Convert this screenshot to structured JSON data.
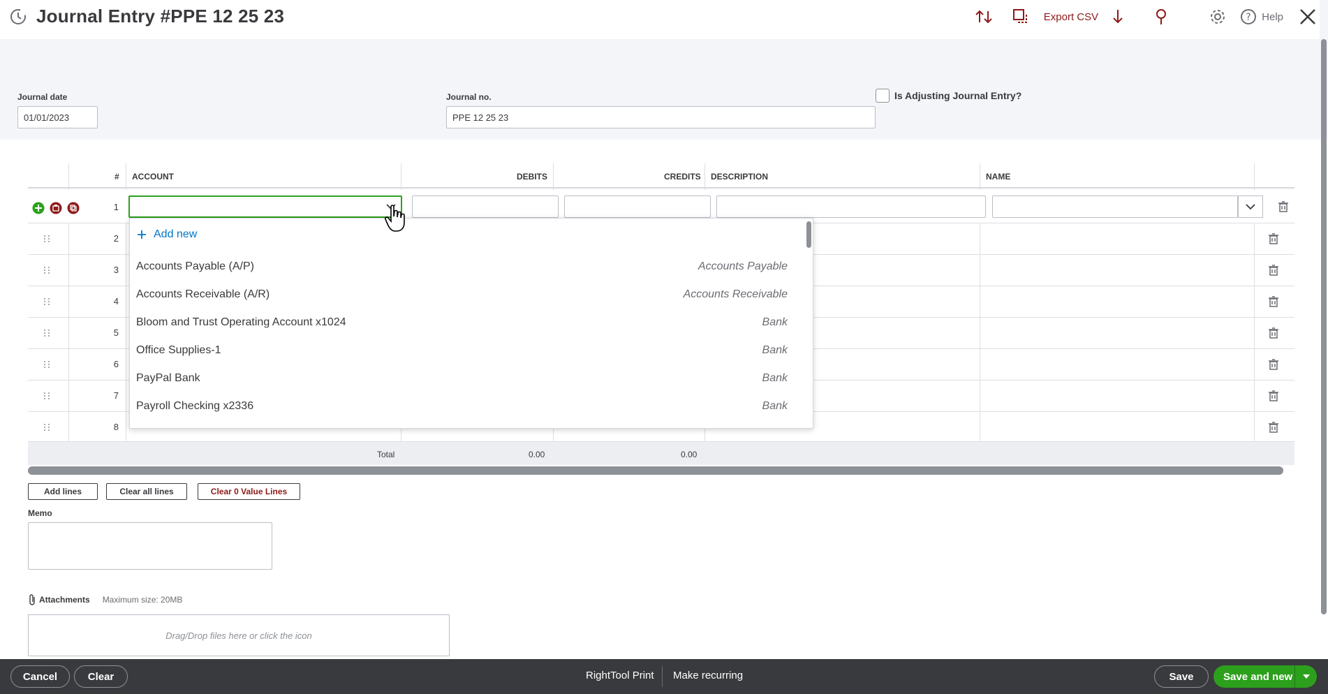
{
  "header": {
    "title": "Journal Entry #PPE 12 25 23",
    "export_label": "Export CSV",
    "help_label": "Help"
  },
  "fields": {
    "journal_date_label": "Journal date",
    "journal_date_value": "01/01/2023",
    "journal_no_label": "Journal no.",
    "journal_no_value": "PPE 12 25 23",
    "adjusting_label": "Is Adjusting Journal Entry?"
  },
  "grid": {
    "columns": [
      "#",
      "ACCOUNT",
      "DEBITS",
      "CREDITS",
      "DESCRIPTION",
      "NAME"
    ],
    "rows": [
      "1",
      "2",
      "3",
      "4",
      "5",
      "6",
      "7",
      "8"
    ],
    "total_label": "Total",
    "total_debits": "0.00",
    "total_credits": "0.00"
  },
  "actions": {
    "add_lines": "Add lines",
    "clear_all_lines": "Clear all lines",
    "clear_zero_lines": "Clear 0 Value Lines"
  },
  "memo": {
    "label": "Memo"
  },
  "attachments": {
    "label": "Attachments",
    "max_size": "Maximum size: 20MB",
    "drop_text": "Drag/Drop files here or click the icon"
  },
  "account_dropdown": {
    "add_new": "Add new",
    "items": [
      {
        "name": "Accounts Payable (A/P)",
        "type": "Accounts Payable"
      },
      {
        "name": "Accounts Receivable (A/R)",
        "type": "Accounts Receivable"
      },
      {
        "name": "Bloom and Trust Operating Account x1024",
        "type": "Bank"
      },
      {
        "name": "Office Supplies-1",
        "type": "Bank"
      },
      {
        "name": "PayPal Bank",
        "type": "Bank"
      },
      {
        "name": "Payroll Checking x2336",
        "type": "Bank"
      }
    ]
  },
  "footer": {
    "cancel": "Cancel",
    "clear": "Clear",
    "print": "RightTool Print",
    "recurring": "Make recurring",
    "save": "Save",
    "save_and_new": "Save and new"
  },
  "colors": {
    "brand_red": "#8d1a1a",
    "green": "#2ca01c",
    "link_blue": "#0077c5",
    "footer_bg": "#393a3d"
  },
  "icons": [
    "history-icon",
    "sort-icon",
    "copy-icon",
    "download-icon",
    "pin-icon",
    "gear-icon",
    "help-icon",
    "close-icon",
    "add-row-icon",
    "paste-icon",
    "duplicate-icon",
    "drag-icon",
    "trash-icon",
    "chevron-down-icon",
    "paperclip-icon",
    "plus-icon",
    "cursor-hand-icon"
  ]
}
